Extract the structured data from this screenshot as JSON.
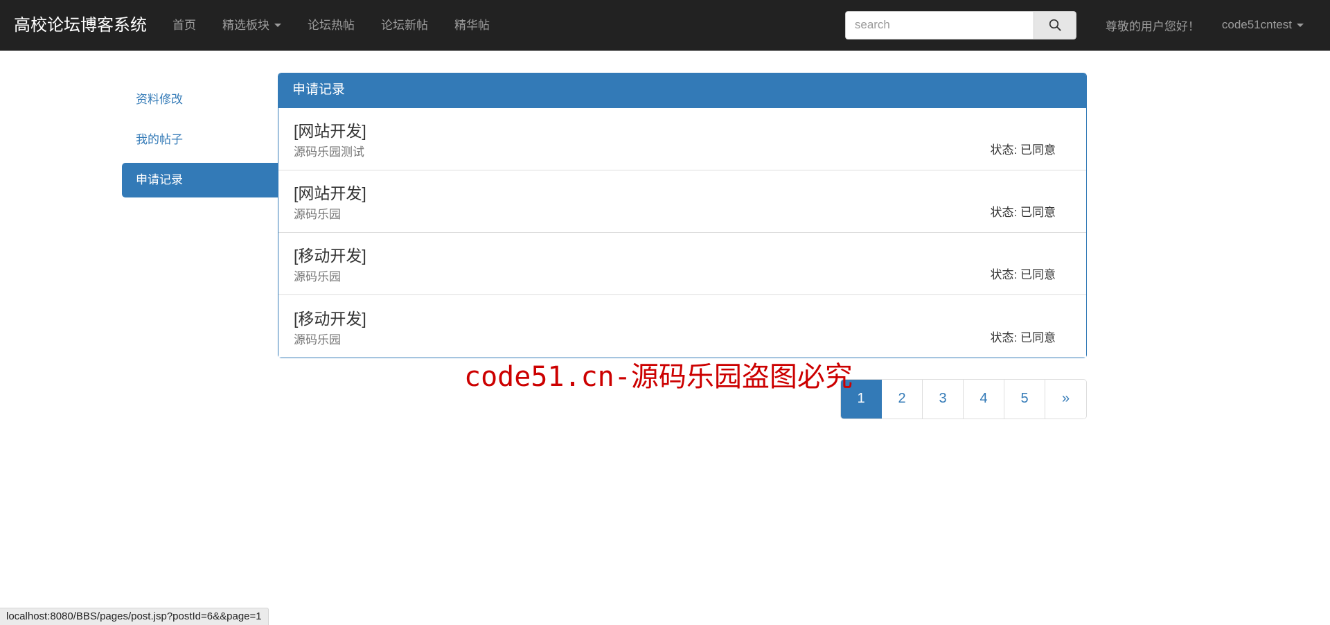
{
  "navbar": {
    "brand": "高校论坛博客系统",
    "links": [
      {
        "label": "首页",
        "has_caret": false
      },
      {
        "label": "精选板块",
        "has_caret": true
      },
      {
        "label": "论坛热帖",
        "has_caret": false
      },
      {
        "label": "论坛新帖",
        "has_caret": false
      },
      {
        "label": "精华帖",
        "has_caret": false
      }
    ],
    "search": {
      "value": "",
      "placeholder": "search",
      "button_icon": "search-icon"
    },
    "greeting": "尊敬的用户您好！",
    "user": "code51cntest",
    "user_caret": "▾"
  },
  "sidebar": {
    "items": [
      {
        "label": "资料修改",
        "active": false
      },
      {
        "label": "我的帖子",
        "active": false
      },
      {
        "label": "申请记录",
        "active": true
      }
    ]
  },
  "panel": {
    "title": "申请记录",
    "status_label": "状态:",
    "rows": [
      {
        "title": "[网站开发]",
        "subtitle": "源码乐园测试",
        "status": "已同意"
      },
      {
        "title": "[网站开发]",
        "subtitle": "源码乐园",
        "status": "已同意"
      },
      {
        "title": "[移动开发]",
        "subtitle": "源码乐园",
        "status": "已同意"
      },
      {
        "title": "[移动开发]",
        "subtitle": "源码乐园",
        "status": "已同意"
      }
    ]
  },
  "pagination": {
    "pages": [
      "1",
      "2",
      "3",
      "4",
      "5"
    ],
    "active": "1",
    "next_label": "»"
  },
  "watermark": "code51.cn-源码乐园盗图必究",
  "statusbar": {
    "url": "localhost:8080/BBS/pages/post.jsp?postId=6&&page=1"
  },
  "colors": {
    "navbar_bg": "#222222",
    "primary": "#337ab7",
    "watermark": "#cc0000",
    "muted_text": "#777777",
    "nav_text": "#9d9d9d"
  }
}
